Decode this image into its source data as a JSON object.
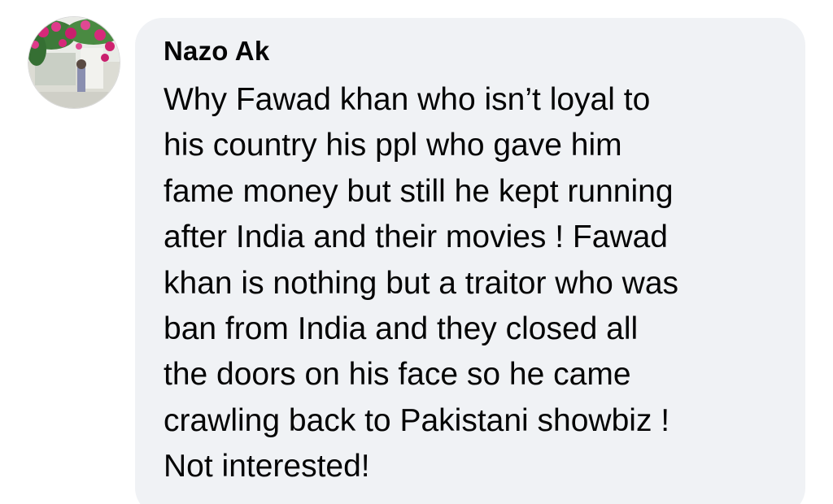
{
  "comment": {
    "author_name": "Nazo Ak",
    "avatar_icon": "profile-photo-flowers",
    "text": "Why Fawad khan who isn’t loyal to\nhis country his ppl who gave him\nfame money but still he kept running\nafter India and their movies ! Fawad\nkhan is nothing but a traitor who was\nban from India and they closed all\nthe doors on his face so he came\ncrawling back to Pakistani showbiz !\nNot interested!"
  },
  "colors": {
    "bubble_background": "#f0f2f5",
    "text": "#050505",
    "page_background": "#ffffff"
  }
}
